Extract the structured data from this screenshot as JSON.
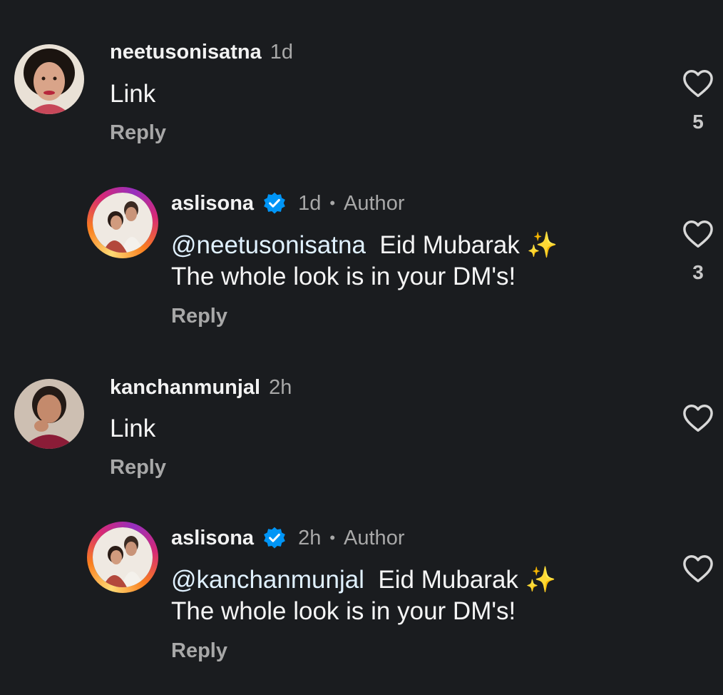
{
  "comments": [
    {
      "username": "neetusonisatna",
      "time": "1d",
      "text": "Link",
      "reply_label": "Reply",
      "likes": "5"
    },
    {
      "username": "aslisona",
      "time": "1d",
      "separator": "•",
      "author_label": "Author",
      "mention": "@neetusonisatna",
      "text_line1": "Eid Mubarak",
      "emoji": "✨",
      "text_line2": "The whole look is in your DM's!",
      "reply_label": "Reply",
      "likes": "3"
    },
    {
      "username": "kanchanmunjal",
      "time": "2h",
      "text": "Link",
      "reply_label": "Reply"
    },
    {
      "username": "aslisona",
      "time": "2h",
      "separator": "•",
      "author_label": "Author",
      "mention": "@kanchanmunjal",
      "text_line1": "Eid Mubarak",
      "emoji": "✨",
      "text_line2": "The whole look is in your DM's!",
      "reply_label": "Reply"
    }
  ],
  "colors": {
    "background": "#1a1c1f",
    "verified": "#0095f6",
    "secondary_text": "#a8a8a8"
  },
  "icons": {
    "like": "heart-outline-icon",
    "verified": "verified-badge-icon",
    "mention": "at-sign-icon"
  }
}
